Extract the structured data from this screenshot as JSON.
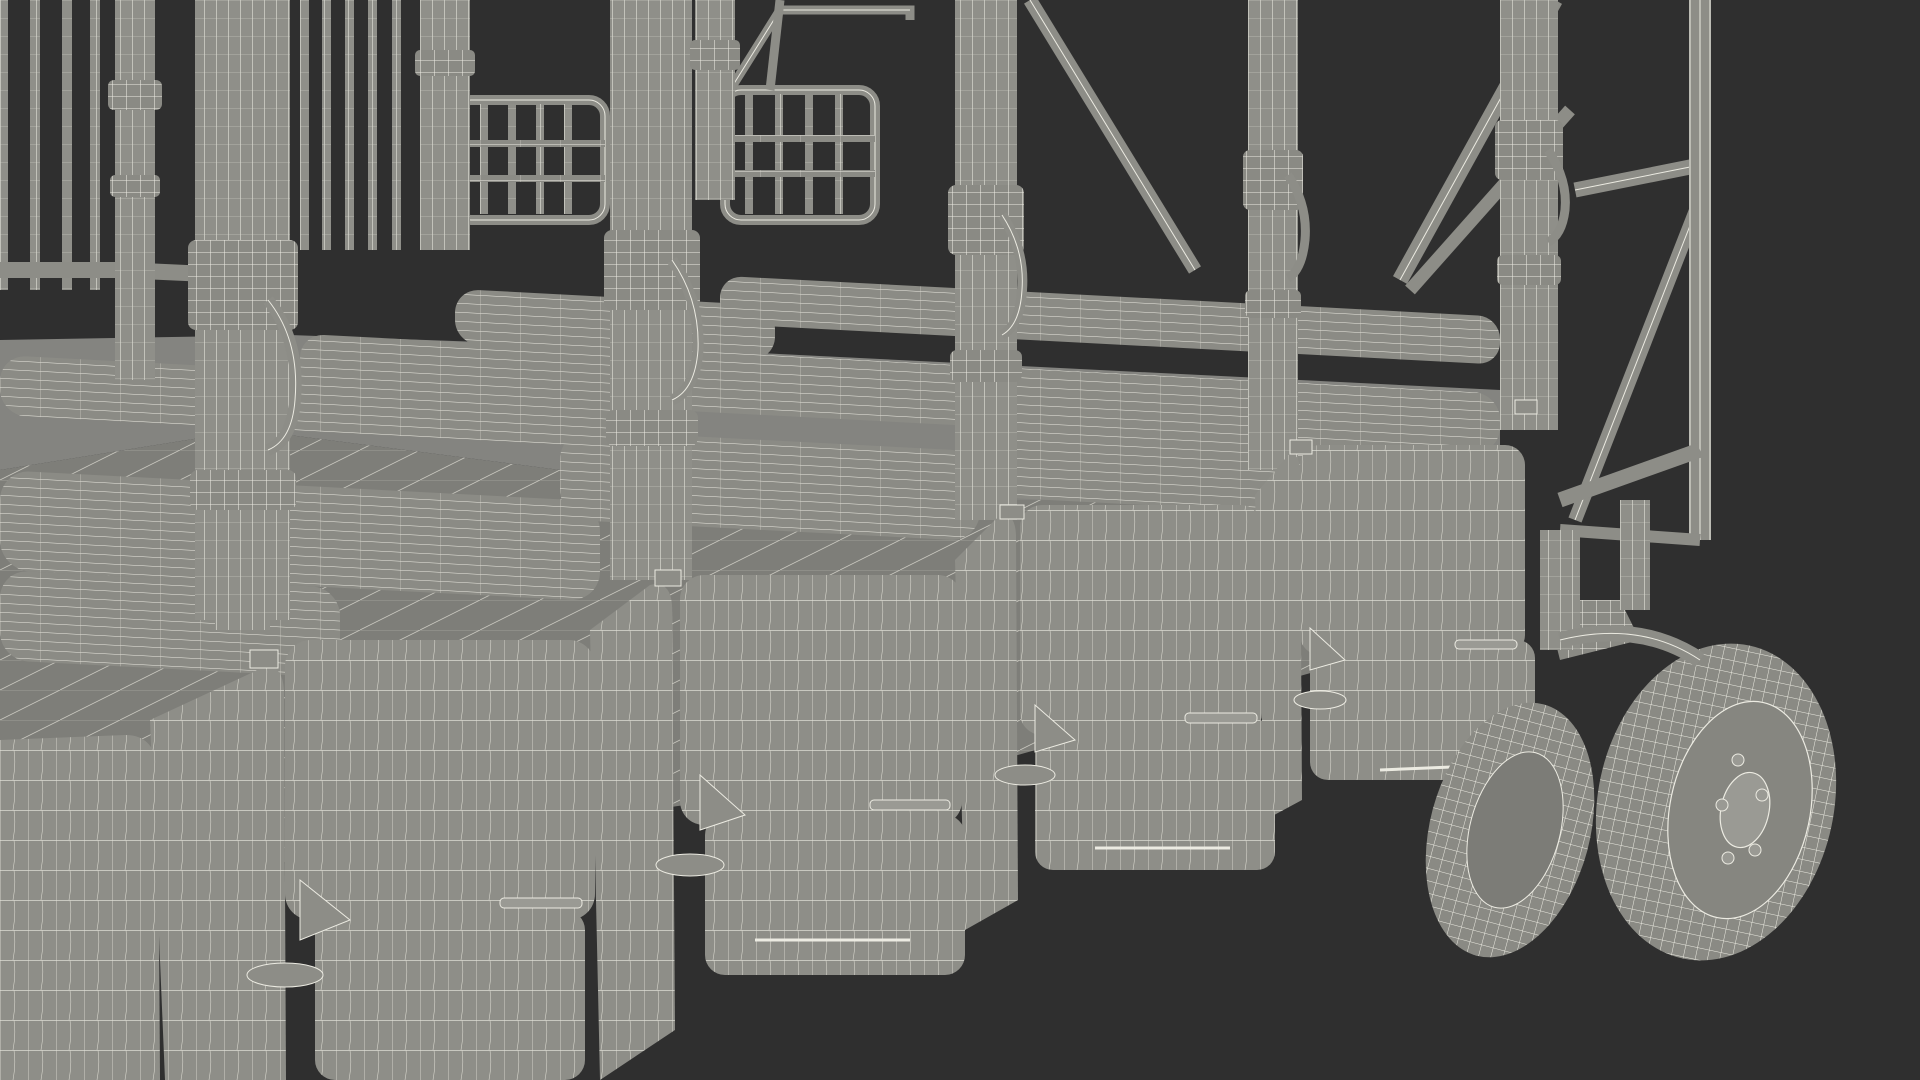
{
  "scene": {
    "subject": "starting-gate-wireframe-render",
    "colors": {
      "background": "#2f2f2f",
      "surface": "#8d8d87",
      "surface_dark": "#6f6f6a",
      "surface_light": "#a6a6a0",
      "wire": "#ecebe2",
      "shadow": "#5a5a56",
      "tire": "#878781"
    }
  }
}
